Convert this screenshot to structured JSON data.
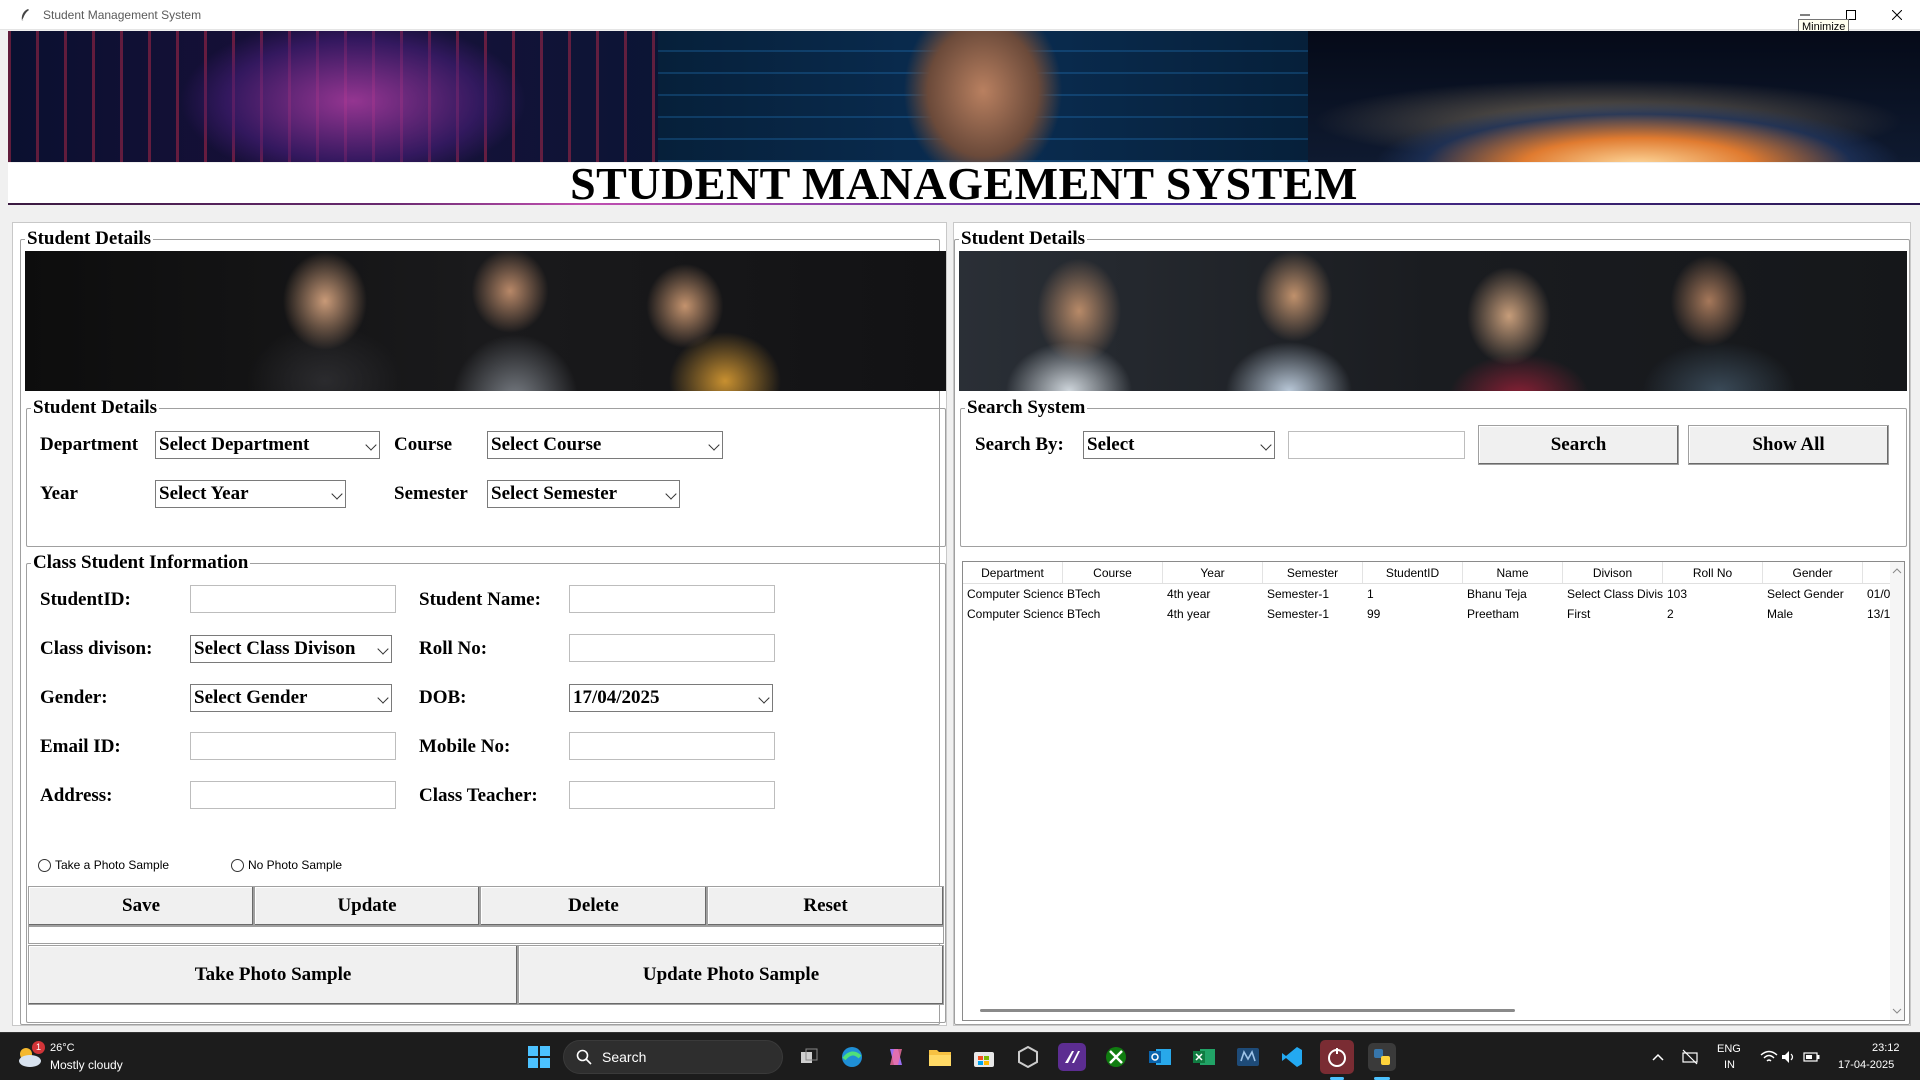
{
  "window": {
    "title": "Student Management System",
    "tooltip": "Minimize"
  },
  "heading": "STUDENT MANAGEMENT SYSTEM",
  "left": {
    "frame_title": "Student Details",
    "student_details": {
      "legend": "Student Details",
      "department_label": "Department",
      "department_value": "Select Department",
      "course_label": "Course",
      "course_value": "Select Course",
      "year_label": "Year",
      "year_value": "Select Year",
      "semester_label": "Semester",
      "semester_value": "Select Semester"
    },
    "class_info": {
      "legend": "Class Student Information",
      "student_id_label": "StudentID:",
      "student_name_label": "Student Name:",
      "class_division_label": "Class divison:",
      "class_division_value": "Select Class Divison",
      "roll_no_label": "Roll No:",
      "gender_label": "Gender:",
      "gender_value": "Select Gender",
      "dob_label": "DOB:",
      "dob_value": "17/04/2025",
      "email_label": "Email ID:",
      "mobile_label": "Mobile No:",
      "address_label": "Address:",
      "class_teacher_label": "Class Teacher:",
      "radio_take": "Take a Photo Sample",
      "radio_no": "No Photo Sample"
    },
    "buttons": {
      "save": "Save",
      "update": "Update",
      "delete": "Delete",
      "reset": "Reset",
      "take_photo": "Take Photo Sample",
      "update_photo": "Update Photo Sample"
    }
  },
  "right": {
    "frame_title": "Student Details",
    "search": {
      "legend": "Search System",
      "search_by_label": "Search By:",
      "search_by_value": "Select",
      "search_button": "Search",
      "show_all_button": "Show All"
    },
    "table": {
      "columns": [
        "Department",
        "Course",
        "Year",
        "Semester",
        "StudentID",
        "Name",
        "Divison",
        "Roll No",
        "Gender",
        ""
      ],
      "rows": [
        [
          "Computer Science",
          "BTech",
          "4th year",
          "Semester-1",
          "1",
          "Bhanu Teja",
          "Select Class Division",
          "103",
          "Select Gender",
          "01/0"
        ],
        [
          "Computer Science",
          "BTech",
          "4th year",
          "Semester-1",
          "99",
          "Preetham",
          "First",
          "2",
          "Male",
          "13/1"
        ]
      ]
    }
  },
  "taskbar": {
    "weather_temp": "26°C",
    "weather_desc": "Mostly cloudy",
    "weather_badge": "1",
    "search_placeholder": "Search",
    "lang_top": "ENG",
    "lang_bottom": "IN",
    "time": "23:12",
    "date": "17-04-2025"
  }
}
